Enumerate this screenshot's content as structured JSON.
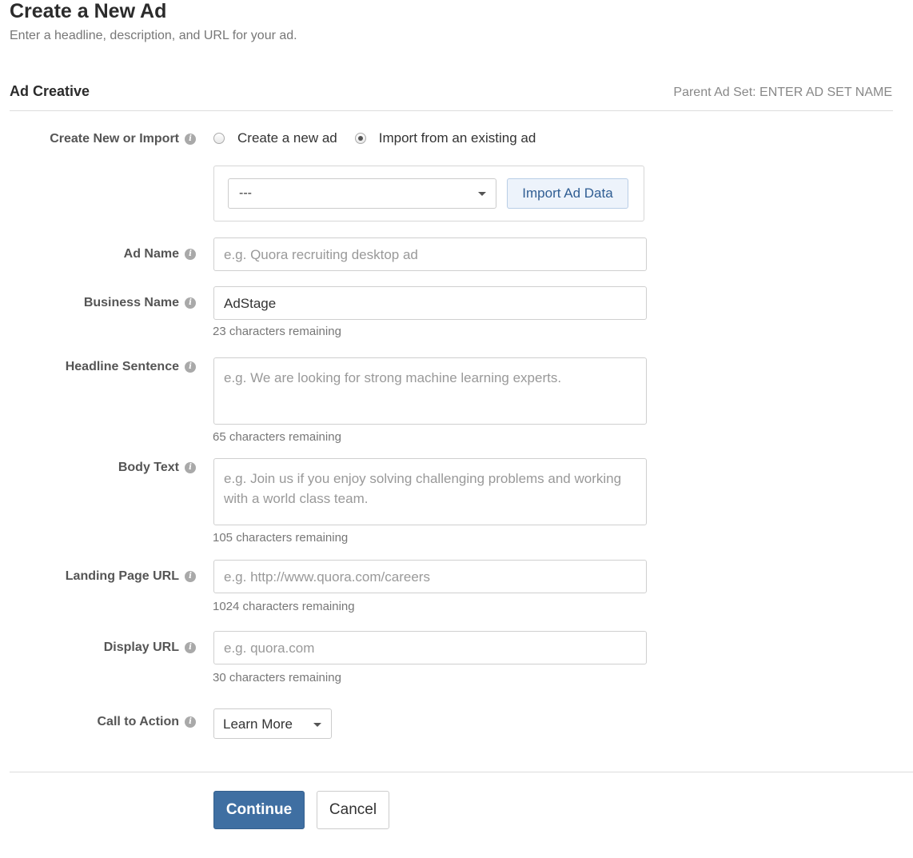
{
  "header": {
    "title": "Create a New Ad",
    "subtitle": "Enter a headline, description, and URL for your ad."
  },
  "section": {
    "title": "Ad Creative",
    "parent_ad_set": "Parent Ad Set: ENTER AD SET NAME"
  },
  "create_or_import": {
    "label": "Create New or Import",
    "options": [
      {
        "label": "Create a new ad",
        "selected": false
      },
      {
        "label": "Import from an existing ad",
        "selected": true
      }
    ],
    "select_value": "---",
    "import_button": "Import Ad Data"
  },
  "ad_name": {
    "label": "Ad Name",
    "placeholder": "e.g. Quora recruiting desktop ad",
    "value": ""
  },
  "business_name": {
    "label": "Business Name",
    "value": "AdStage",
    "remaining": "23 characters remaining"
  },
  "headline": {
    "label": "Headline Sentence",
    "placeholder": "e.g. We are looking for strong machine learning experts.",
    "remaining": "65 characters remaining"
  },
  "body_text": {
    "label": "Body Text",
    "placeholder": "e.g. Join us if you enjoy solving challenging problems and working with a world class team.",
    "remaining": "105 characters remaining"
  },
  "landing_url": {
    "label": "Landing Page URL",
    "placeholder": "e.g. http://www.quora.com/careers",
    "remaining": "1024 characters remaining"
  },
  "display_url": {
    "label": "Display URL",
    "placeholder": "e.g. quora.com",
    "remaining": "30 characters remaining"
  },
  "call_to_action": {
    "label": "Call to Action",
    "value": "Learn More"
  },
  "actions": {
    "continue": "Continue",
    "cancel": "Cancel"
  },
  "icons": {
    "info": "info-icon",
    "dropdown": "caret-down-icon"
  },
  "colors": {
    "primary": "#3f6fa2",
    "import_button_bg": "#edf3fb",
    "import_button_text": "#2f5d93"
  }
}
